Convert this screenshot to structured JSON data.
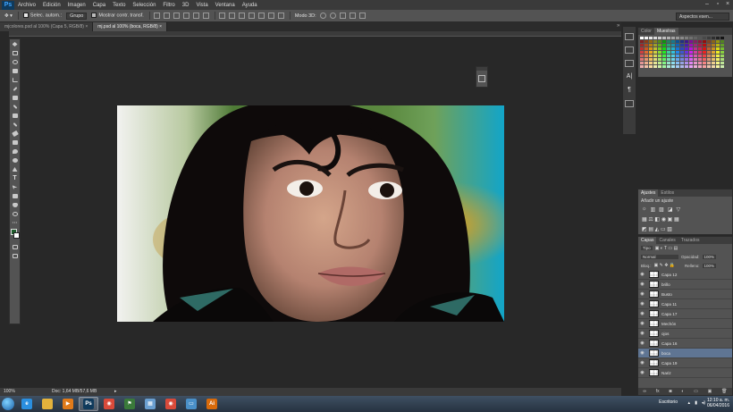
{
  "app": {
    "logo": "Ps"
  },
  "menubar": {
    "items": [
      "Archivo",
      "Edición",
      "Imagen",
      "Capa",
      "Texto",
      "Selección",
      "Filtro",
      "3D",
      "Vista",
      "Ventana",
      "Ayuda"
    ]
  },
  "options": {
    "autoselect_label": "Selec. autom.:",
    "autoselect_value": "Grupo",
    "transform_label": "Mostrar contr. transf.",
    "mode3d_label": "Modo 3D:",
    "workspace": "Aspectos esen..."
  },
  "tabs": [
    {
      "label": "mjcolores.psd al 100% (Capa 5, RGB/8) ×",
      "active": false
    },
    {
      "label": "mj.psd al 100% (boca, RGB/8) ×",
      "active": true
    }
  ],
  "status": {
    "zoom": "100%",
    "doc": "Doc: 1,64 MB/57,6 MB"
  },
  "swatches_panel": {
    "tabs": [
      "Color",
      "Muestras"
    ],
    "active": "Muestras"
  },
  "adjust_panel": {
    "tabs": [
      "Ajustes",
      "Estilos"
    ],
    "heading": "Añadir un ajuste"
  },
  "layers_panel": {
    "tabs": [
      "Capas",
      "Canales",
      "Trazados"
    ],
    "filter": "Tipo",
    "blend": "Normal",
    "opacity_label": "Opacidad:",
    "opacity": "100%",
    "lock_label": "Bloq.:",
    "fill_label": "Relleno:",
    "fill": "100%",
    "layers": [
      {
        "name": "Capa 12",
        "selected": false
      },
      {
        "name": "brillo",
        "selected": false
      },
      {
        "name": "Busto",
        "selected": false
      },
      {
        "name": "Capa 11",
        "selected": false
      },
      {
        "name": "Capa 17",
        "selected": false
      },
      {
        "name": "Mechón",
        "selected": false
      },
      {
        "name": "ojos",
        "selected": false
      },
      {
        "name": "Capa 16",
        "selected": false
      },
      {
        "name": "boca",
        "selected": true
      },
      {
        "name": "Capa 19",
        "selected": false
      },
      {
        "name": "Nariz",
        "selected": false
      }
    ]
  },
  "taskbar": {
    "lang": "Escritorio",
    "time": "12:10 a. m.",
    "date": "06/04/2016",
    "apps": [
      {
        "icon": "ie-icon",
        "color": "#2a8fe0",
        "glyph": "e",
        "active": false
      },
      {
        "icon": "explorer-icon",
        "color": "#e3b23c",
        "glyph": "",
        "active": false
      },
      {
        "icon": "media-player-icon",
        "color": "#e07a1a",
        "glyph": "▶",
        "active": false
      },
      {
        "icon": "photoshop-icon",
        "color": "#0f3a5c",
        "glyph": "Ps",
        "active": true
      },
      {
        "icon": "chrome-icon",
        "color": "#d84a3a",
        "glyph": "◉",
        "active": false
      },
      {
        "icon": "flag-icon",
        "color": "#3a7a3a",
        "glyph": "⚑",
        "active": false
      },
      {
        "icon": "photos-icon",
        "color": "#6a9fd0",
        "glyph": "▦",
        "active": false
      },
      {
        "icon": "chrome-icon",
        "color": "#d84a3a",
        "glyph": "◉",
        "active": false
      },
      {
        "icon": "image-viewer-icon",
        "color": "#4a90c8",
        "glyph": "▭",
        "active": false
      },
      {
        "icon": "illustrator-icon",
        "color": "#d86a0a",
        "glyph": "Ai",
        "active": false
      }
    ]
  }
}
